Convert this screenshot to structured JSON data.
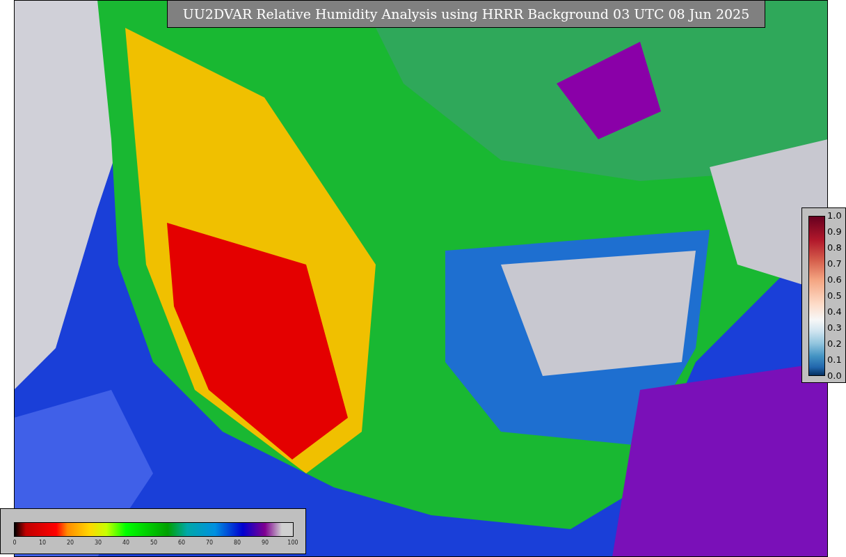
{
  "title": "UU2DVAR Relative Humidity Analysis using HRRR Background 03 UTC 08 Jun 2025",
  "innovation_legend": {
    "ticks": [
      "1.0",
      "0.9",
      "0.8",
      "0.7",
      "0.6",
      "0.5",
      "0.4",
      "0.3",
      "0.2",
      "0.1",
      "0.0"
    ]
  },
  "humidity_legend": {
    "ticks": [
      "0",
      "10",
      "20",
      "30",
      "40",
      "50",
      "60",
      "70",
      "80",
      "90",
      "100"
    ]
  }
}
